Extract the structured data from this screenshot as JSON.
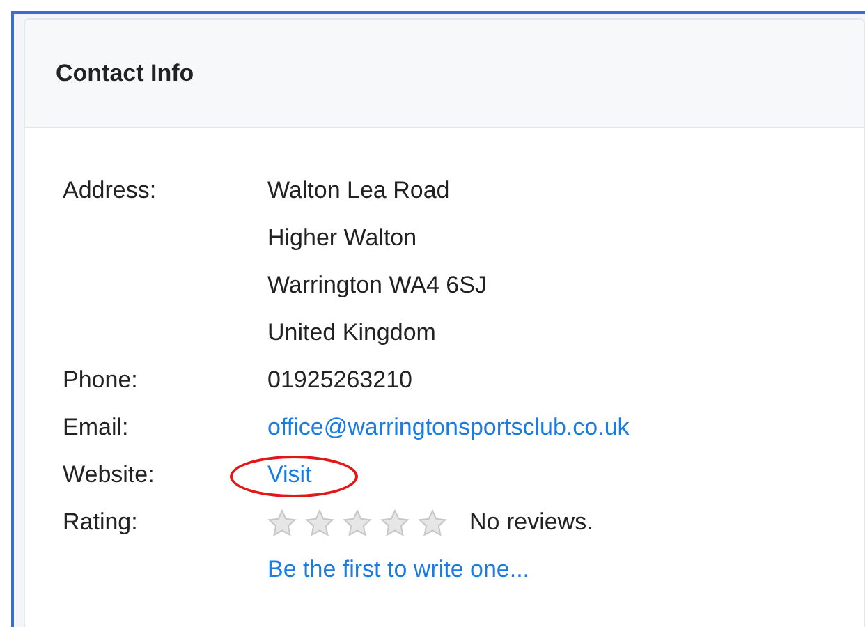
{
  "card": {
    "title": "Contact Info"
  },
  "rows": [
    {
      "label": "Address:",
      "kind": "lines",
      "lines": [
        "Walton Lea Road",
        "Higher Walton",
        "Warrington WA4 6SJ",
        "United Kingdom"
      ]
    },
    {
      "label": "Phone:",
      "kind": "text",
      "value": "01925263210"
    },
    {
      "label": "Email:",
      "kind": "link",
      "value": "office@warringtonsportsclub.co.uk"
    },
    {
      "label": "Website:",
      "kind": "link",
      "value": "Visit",
      "circled": true
    },
    {
      "label": "Rating:",
      "kind": "rating",
      "stars": 0,
      "note": "No reviews.",
      "link": "Be the first to write one..."
    }
  ]
}
